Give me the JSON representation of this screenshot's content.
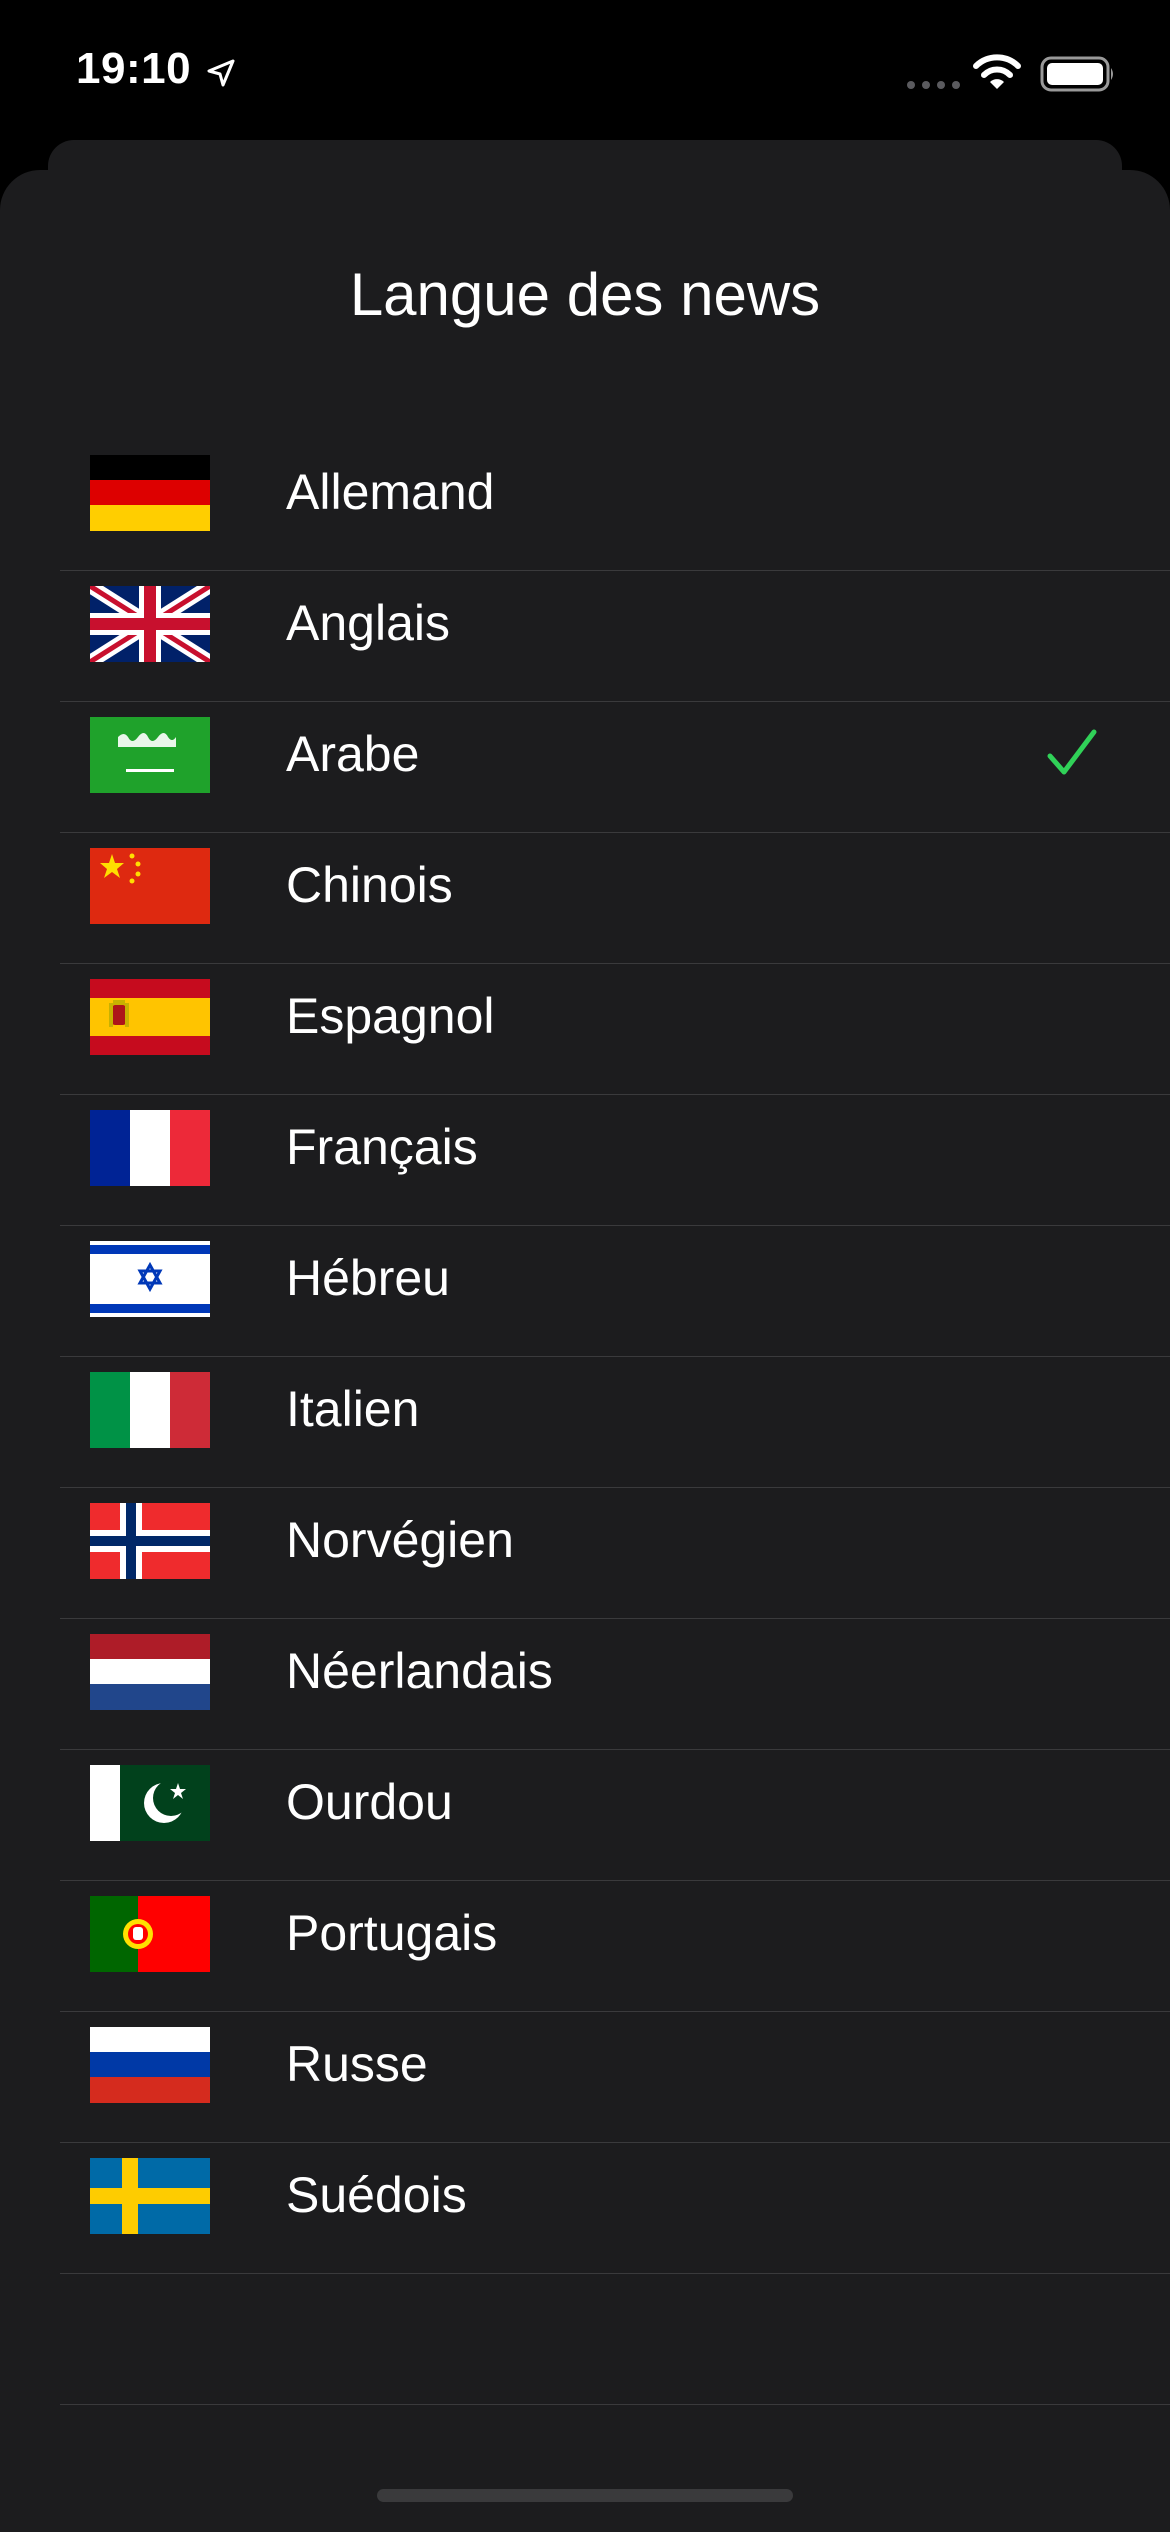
{
  "status_bar": {
    "time": "19:10",
    "icons": [
      "location-arrow-icon",
      "signal-dots-icon",
      "wifi-icon",
      "battery-icon"
    ]
  },
  "sheet": {
    "title": "Langue des news"
  },
  "languages": [
    {
      "label": "Allemand",
      "flag": "germany-flag-icon"
    },
    {
      "label": "Anglais",
      "flag": "uk-flag-icon"
    },
    {
      "label": "Arabe",
      "flag": "saudi-arabia-flag-icon",
      "selected": true
    },
    {
      "label": "Chinois",
      "flag": "china-flag-icon"
    },
    {
      "label": "Espagnol",
      "flag": "spain-flag-icon"
    },
    {
      "label": "Français",
      "flag": "france-flag-icon"
    },
    {
      "label": "Hébreu",
      "flag": "israel-flag-icon"
    },
    {
      "label": "Italien",
      "flag": "italy-flag-icon"
    },
    {
      "label": "Norvégien",
      "flag": "norway-flag-icon"
    },
    {
      "label": "Néerlandais",
      "flag": "netherlands-flag-icon"
    },
    {
      "label": "Ourdou",
      "flag": "pakistan-flag-icon"
    },
    {
      "label": "Portugais",
      "flag": "portugal-flag-icon"
    },
    {
      "label": "Russe",
      "flag": "russia-flag-icon"
    },
    {
      "label": "Suédois",
      "flag": "sweden-flag-icon"
    }
  ],
  "colors": {
    "background": "#000000",
    "sheet": "#1c1c1e",
    "separator": "#3a3a3c",
    "checkmark": "#30d158",
    "text": "#ffffff"
  }
}
